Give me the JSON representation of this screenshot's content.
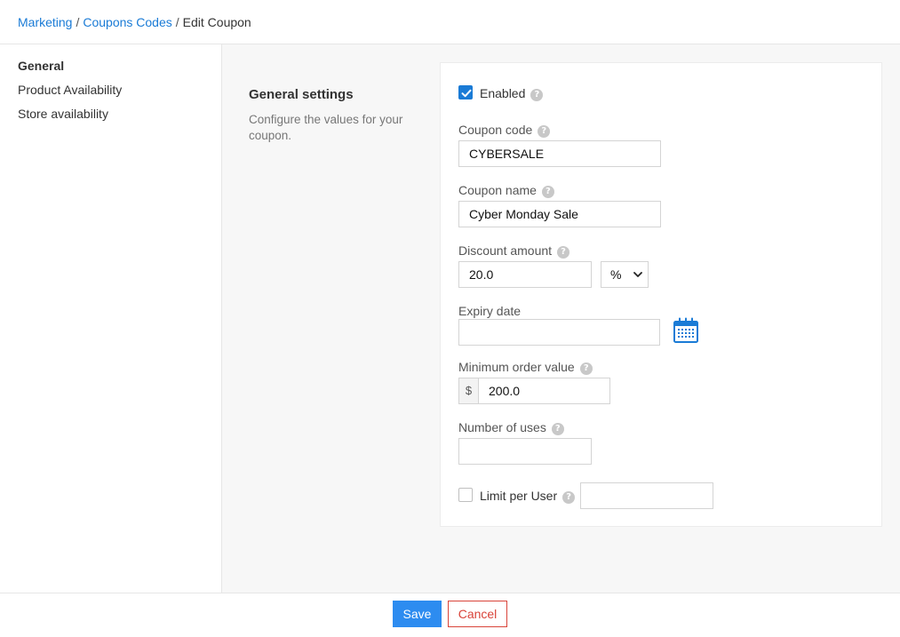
{
  "breadcrumb": {
    "items": [
      {
        "label": "Marketing"
      },
      {
        "label": "Coupons Codes"
      },
      {
        "label": "Edit Coupon"
      }
    ],
    "separator": "/"
  },
  "sidebar": {
    "items": [
      {
        "label": "General",
        "active": true
      },
      {
        "label": "Product Availability",
        "active": false
      },
      {
        "label": "Store availability",
        "active": false
      }
    ]
  },
  "section": {
    "title": "General settings",
    "description": "Configure the values for your coupon."
  },
  "form": {
    "enabled": {
      "label": "Enabled",
      "checked": true
    },
    "coupon_code": {
      "label": "Coupon code",
      "value": "CYBERSALE"
    },
    "coupon_name": {
      "label": "Coupon name",
      "value": "Cyber Monday Sale"
    },
    "discount_amount": {
      "label": "Discount amount",
      "value": "20.0",
      "unit_selected": "%"
    },
    "expiry_date": {
      "label": "Expiry date",
      "value": ""
    },
    "minimum_order_value": {
      "label": "Minimum order value",
      "prefix": "$",
      "value": "200.0"
    },
    "number_of_uses": {
      "label": "Number of uses",
      "value": ""
    },
    "limit_per_user": {
      "label": "Limit per User",
      "checked": false,
      "value": ""
    }
  },
  "help_icon_glyph": "?",
  "footer": {
    "save_label": "Save",
    "cancel_label": "Cancel"
  },
  "colors": {
    "link": "#1a7bd6",
    "primary": "#2d8cf0",
    "danger": "#d9443a",
    "main_bg": "#f7f7f7"
  },
  "icons": {
    "calendar": "calendar-icon",
    "help": "question-circle-icon",
    "check": "checkmark-icon",
    "dropdown": "chevron-down-icon"
  }
}
